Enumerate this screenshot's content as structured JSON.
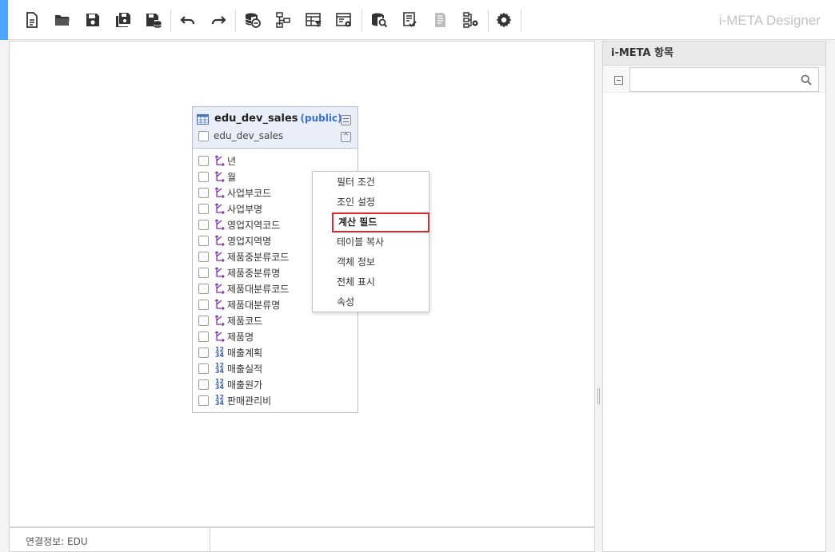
{
  "toolbar": {
    "brand": "i-META Designer",
    "buttons": [
      {
        "name": "new-document-icon"
      },
      {
        "name": "open-folder-icon"
      },
      {
        "name": "save-icon"
      },
      {
        "name": "save-as-icon"
      },
      {
        "name": "save-to-db-icon"
      },
      {
        "name": "undo-icon"
      },
      {
        "name": "redo-icon"
      },
      {
        "name": "db-connection-icon"
      },
      {
        "name": "hierarchy-icon"
      },
      {
        "name": "table-filter-icon"
      },
      {
        "name": "table-settings-icon"
      },
      {
        "name": "db-search-icon"
      },
      {
        "name": "checklist-icon"
      },
      {
        "name": "document-icon"
      },
      {
        "name": "tree-settings-icon"
      },
      {
        "name": "gear-icon"
      }
    ]
  },
  "colors": {
    "accent": "#4da6ff",
    "schema": "#3a6fd1",
    "selected_border": "#e2262e",
    "dimension_icon": "#7b2fa8",
    "measure_icon": "#3a5fbf"
  },
  "table": {
    "name": "edu_dev_sales",
    "schema": "(public)",
    "alias": "edu_dev_sales",
    "collapse_symbol": "^",
    "columns": [
      {
        "label": "년",
        "type": "dimension"
      },
      {
        "label": "월",
        "type": "dimension"
      },
      {
        "label": "사업부코드",
        "type": "dimension"
      },
      {
        "label": "사업부명",
        "type": "dimension"
      },
      {
        "label": "영업지역코드",
        "type": "dimension"
      },
      {
        "label": "영업지역명",
        "type": "dimension"
      },
      {
        "label": "제품중분류코드",
        "type": "dimension"
      },
      {
        "label": "제품중분류명",
        "type": "dimension"
      },
      {
        "label": "제품대분류코드",
        "type": "dimension"
      },
      {
        "label": "제품대분류명",
        "type": "dimension"
      },
      {
        "label": "제품코드",
        "type": "dimension"
      },
      {
        "label": "제품명",
        "type": "dimension"
      },
      {
        "label": "매출계획",
        "type": "measure"
      },
      {
        "label": "매출실적",
        "type": "measure"
      },
      {
        "label": "매출원가",
        "type": "measure"
      },
      {
        "label": "판매관리비",
        "type": "measure"
      }
    ]
  },
  "context_menu": {
    "items": [
      {
        "label": "필터 조건"
      },
      {
        "label": "조인 설정"
      },
      {
        "label": "계산 필드",
        "selected": true
      },
      {
        "label": "테이블 복사"
      },
      {
        "label": "객체 정보"
      },
      {
        "label": "전체 표시"
      },
      {
        "label": "속성"
      }
    ]
  },
  "status": {
    "connection": "연결정보: EDU"
  },
  "panel": {
    "title": "i-META 항목",
    "search_value": "",
    "search_placeholder": ""
  }
}
